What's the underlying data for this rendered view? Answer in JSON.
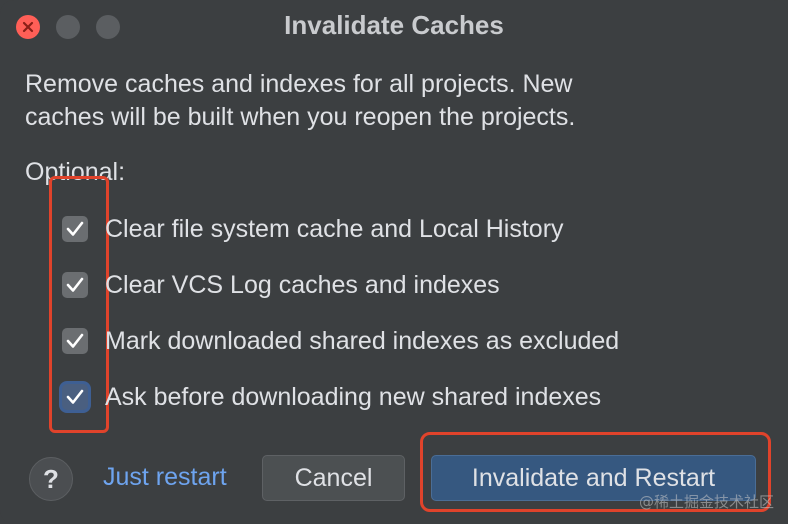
{
  "window": {
    "title": "Invalidate Caches"
  },
  "description": {
    "line1": "Remove caches and indexes for all projects. New",
    "line2": "caches will be built when you reopen the projects."
  },
  "optional_label": "Optional:",
  "options": [
    {
      "label": "Clear file system cache and Local History",
      "checked": true
    },
    {
      "label": "Clear VCS Log caches and indexes",
      "checked": true
    },
    {
      "label": "Mark downloaded shared indexes as excluded",
      "checked": true
    },
    {
      "label": "Ask before downloading new shared indexes",
      "checked": true,
      "focused": true
    }
  ],
  "footer": {
    "help_label": "?",
    "just_restart": "Just restart",
    "cancel": "Cancel",
    "invalidate_restart": "Invalidate and Restart"
  },
  "watermark": "@稀土掘金技术社区",
  "colors": {
    "background": "#3c3f41",
    "link": "#6ea4ef",
    "primary_button": "#365880",
    "annotation": "#e0432b",
    "close_button": "#ff5f57"
  }
}
